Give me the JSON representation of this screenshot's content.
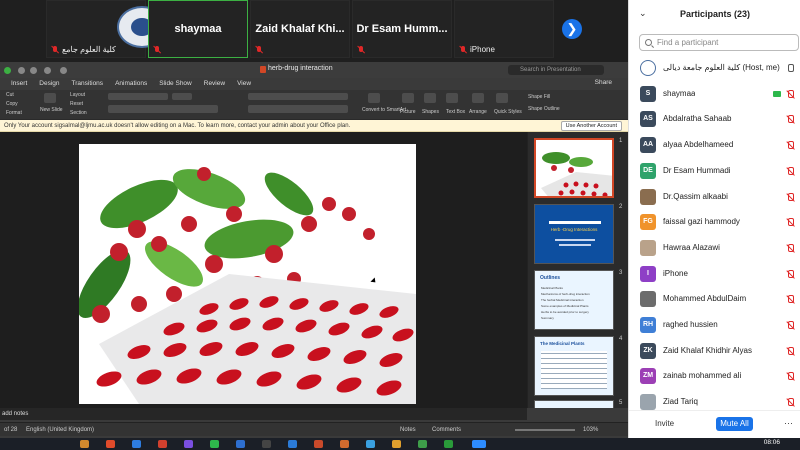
{
  "top_strip": {
    "tiles": [
      {
        "name": "",
        "sub": "كلية العلوم جامع"
      },
      {
        "name": "shaymaa",
        "sub": ""
      },
      {
        "name": "Zaid Khalaf Khi...",
        "sub": ""
      },
      {
        "name": "Dr Esam Humm...",
        "sub": ""
      },
      {
        "name": "",
        "sub": "iPhone"
      }
    ],
    "next_glyph": "❯"
  },
  "ppt": {
    "doc_title": "herb-drug interaction",
    "search_placeholder": "Search in Presentation",
    "menu": [
      "Insert",
      "Design",
      "Transitions",
      "Animations",
      "Slide Show",
      "Review",
      "View"
    ],
    "share_label": "Share",
    "ribbon_labels": {
      "cut": "Cut",
      "copy": "Copy",
      "format": "Format",
      "layout": "Layout",
      "reset": "Reset",
      "section": "Section",
      "new_slide": "New Slide",
      "convert": "Convert to SmartArt",
      "picture": "Picture",
      "shapes": "Shapes",
      "text_box": "Text Box",
      "arrange": "Arrange",
      "quick_styles": "Quick Styles",
      "shape_fill": "Shape Fill",
      "shape_outline": "Shape Outline"
    },
    "notice_text": "Only   Your account sigsalmal@ljmu.ac.uk doesn't allow editing on a Mac. To learn more, contact your admin about your Office plan.",
    "notice_button": "Use Another Account",
    "thumb_numbers": [
      "1",
      "2",
      "3",
      "4",
      "5"
    ],
    "thumb2_title": "Herb -Drug Interactions",
    "thumb3_title": "Outlines",
    "thumb3_items": [
      "Medicinal Plants",
      "Mechanisms of herb-drug interaction",
      "The herbal Medicinal interaction",
      "Some examples of Medicinal Plants",
      "Herbs to be avoided prior to surgery",
      "Summary"
    ],
    "thumb4_title": "The Medicinal Plants",
    "notes_label": "add notes",
    "status": {
      "slide_count": "of 28",
      "language": "English (United Kingdom)",
      "notes": "Notes",
      "comments": "Comments",
      "zoom": "103%"
    }
  },
  "participants": {
    "title": "Participants (23)",
    "search_placeholder": "Find a participant",
    "list": [
      {
        "initials": "",
        "name": "كلية العلوم جامعة ديالى (Host, me)",
        "color": "#ffffff",
        "mic": "on",
        "logo": true
      },
      {
        "initials": "S",
        "name": "shaymaa",
        "color": "#3b4a5c",
        "mic": "off",
        "video": true
      },
      {
        "initials": "AS",
        "name": "Abdalratha Sahaab",
        "color": "#3b4a5c",
        "mic": "off"
      },
      {
        "initials": "AA",
        "name": "alyaa Abdelhameed",
        "color": "#3b4a5c",
        "mic": "off"
      },
      {
        "initials": "DE",
        "name": "Dr Esam Hummadi",
        "color": "#2fa36b",
        "mic": "off"
      },
      {
        "initials": "",
        "name": "Dr.Qassim alkaabi",
        "color": "#8a6d4f",
        "mic": "off"
      },
      {
        "initials": "FG",
        "name": "faissal gazi hammody",
        "color": "#f0932b",
        "mic": "off"
      },
      {
        "initials": "",
        "name": "Hawraa Alazawi",
        "color": "#b9a28a",
        "mic": "off"
      },
      {
        "initials": "I",
        "name": "iPhone",
        "color": "#8e3fc6",
        "mic": "off"
      },
      {
        "initials": "",
        "name": "Mohammed AbdulDaim",
        "color": "#6c6c6c",
        "mic": "off"
      },
      {
        "initials": "RH",
        "name": "raghed hussien",
        "color": "#3f7fd6",
        "mic": "off"
      },
      {
        "initials": "ZK",
        "name": "Zaid Khalaf Khidhir Alyas",
        "color": "#3b4a5c",
        "mic": "off"
      },
      {
        "initials": "ZM",
        "name": "zainab mohammed ali",
        "color": "#9c3fb5",
        "mic": "off"
      },
      {
        "initials": "",
        "name": "Ziad Tariq",
        "color": "#9aa4ad",
        "mic": "off"
      }
    ],
    "invite_label": "Invite",
    "mute_all_label": "Mute All",
    "more_label": "···"
  },
  "taskbar": {
    "time": "08:06"
  },
  "colors": {
    "accent_blue": "#1a73e8",
    "ppt_accent": "#d24726",
    "muted_red": "#e02828"
  }
}
